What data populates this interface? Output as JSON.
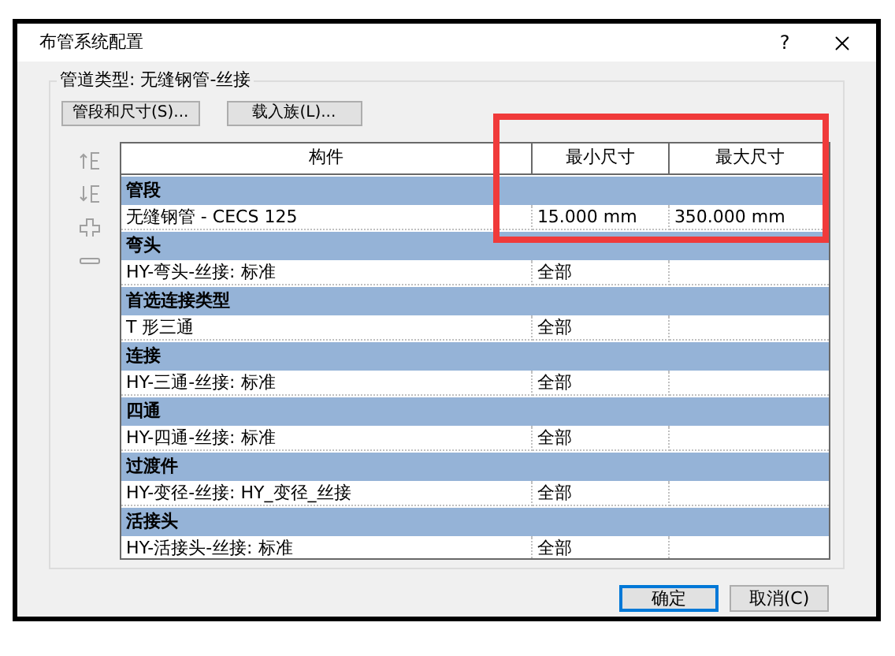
{
  "window": {
    "title": "布管系统配置",
    "help": "?"
  },
  "pipe_type": "管道类型: 无缝钢管-丝接",
  "top_buttons": [
    "管段和尺寸(S)...",
    "载入族(L)..."
  ],
  "table": {
    "columns": [
      "构件",
      "最小尺寸",
      "最大尺寸"
    ],
    "sections": [
      {
        "title": "管段",
        "row": {
          "part": "无缝钢管 - CECS 125",
          "min_size": "15.000 mm",
          "max_size": "350.000 mm"
        }
      },
      {
        "title": "弯头",
        "row": {
          "part": "HY-弯头-丝接: 标准",
          "min_size": "全部"
        }
      },
      {
        "title": "首选连接类型",
        "row": {
          "part": "T 形三通",
          "min_size": "全部"
        }
      },
      {
        "title": "连接",
        "row": {
          "part": "HY-三通-丝接: 标准",
          "min_size": "全部"
        }
      },
      {
        "title": "四通",
        "row": {
          "part": "HY-四通-丝接: 标准",
          "min_size": "全部"
        }
      },
      {
        "title": "过渡件",
        "row": {
          "part": "HY-变径-丝接: HY_变径_丝接",
          "min_size": "全部"
        }
      },
      {
        "title": "活接头",
        "row": {
          "part": "HY-活接头-丝接: 标准",
          "min_size": "全部"
        }
      }
    ]
  },
  "footer_buttons": [
    {
      "label": "确定",
      "default": true
    },
    {
      "label": "取消(C)",
      "default": false
    }
  ]
}
